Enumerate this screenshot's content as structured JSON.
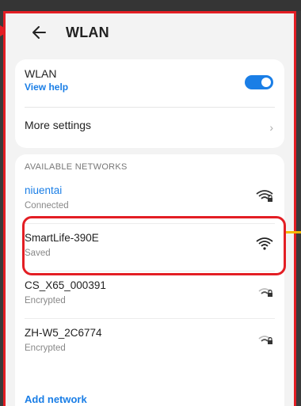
{
  "header": {
    "title": "WLAN"
  },
  "wlan": {
    "label": "WLAN",
    "help": "View help",
    "enabled": true
  },
  "more_settings": {
    "label": "More settings"
  },
  "networks": {
    "heading": "AVAILABLE NETWORKS",
    "items": [
      {
        "name": "niuentai",
        "status": "Connected",
        "icon": "wifi-lock-icon",
        "strength": 3
      },
      {
        "name": "SmartLife-390E",
        "status": "Saved",
        "icon": "wifi-icon",
        "strength": 4
      },
      {
        "name": "CS_X65_000391",
        "status": "Encrypted",
        "icon": "wifi-lock-icon",
        "strength": 2
      },
      {
        "name": "ZH-W5_2C6774",
        "status": "Encrypted",
        "icon": "wifi-lock-icon",
        "strength": 2
      }
    ],
    "add_label": "Add network"
  },
  "colors": {
    "accent": "#1a7ee6",
    "highlight": "#e31e24"
  }
}
